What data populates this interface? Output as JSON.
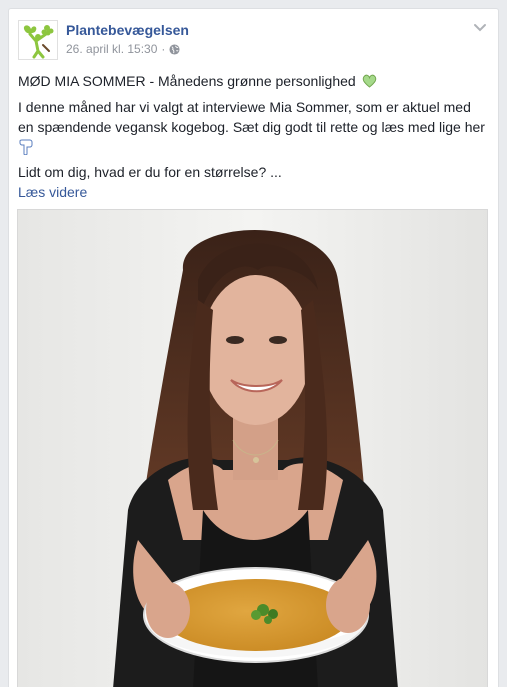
{
  "post": {
    "page_name": "Plantebevægelsen",
    "timestamp": "26. april kl. 15:30",
    "separator": "·",
    "privacy_icon": "globe-icon",
    "options_icon": "chevron-down-icon",
    "headline": "MØD MIA SOMMER - Månedens grønne personlighed",
    "headline_emoji": "green-heart-icon",
    "body": "I denne måned har vi valgt at interviewe Mia Sommer, som er aktuel med en spændende vegansk kogebog. Sæt dig godt til rette og læs med lige her",
    "body_emoji": "pointing-down-icon",
    "teaser": "Lidt om dig, hvad er du for en størrelse? ...",
    "read_more": "Læs videre",
    "photo": "woman-holding-soup-bowl"
  },
  "colors": {
    "link": "#365899",
    "text": "#1d2129",
    "meta": "#90949c",
    "background": "#e9ebee",
    "logo_green": "#8dc63f"
  }
}
